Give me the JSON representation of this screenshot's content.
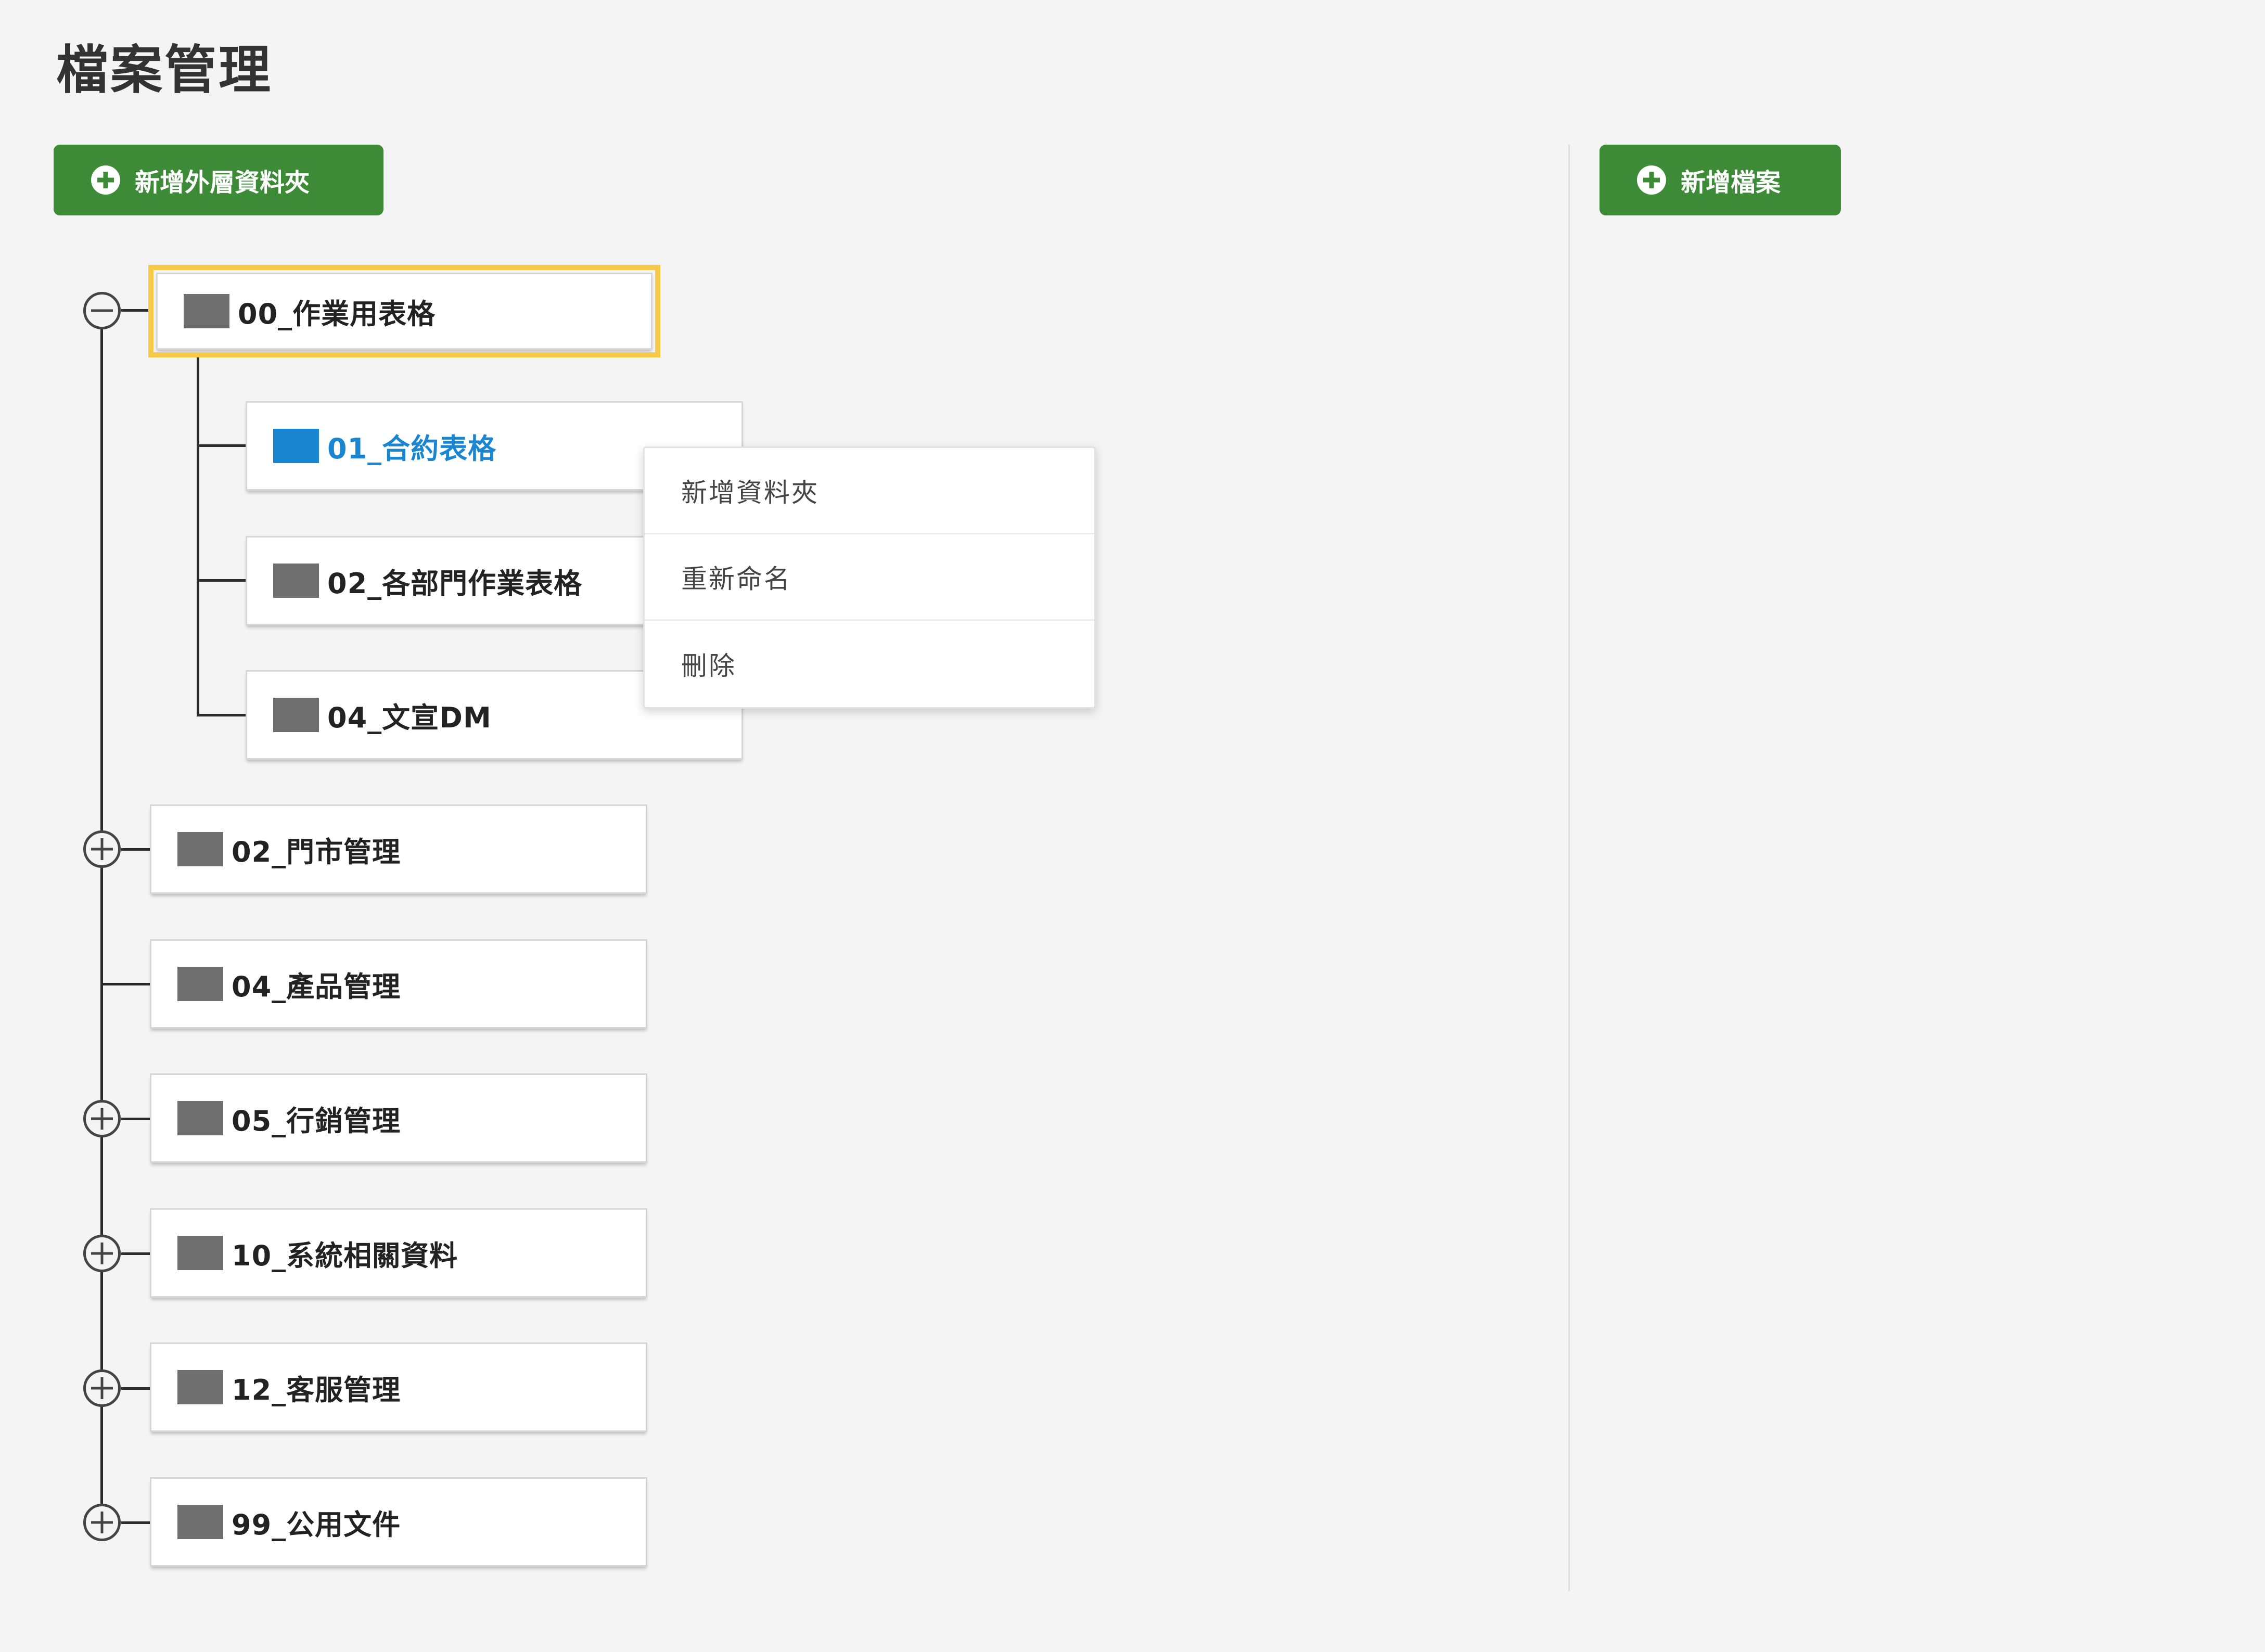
{
  "page": {
    "title": "檔案管理"
  },
  "toolbar": {
    "add_outer_folder_label": "新增外層資料夾",
    "add_file_label": "新增檔案"
  },
  "tree": {
    "root": {
      "label": "00_作業用表格",
      "expanded": true,
      "selected": true,
      "children": [
        {
          "label": "01_合約表格",
          "active": true
        },
        {
          "label": "02_各部門作業表格"
        },
        {
          "label": "04_文宣DM"
        }
      ]
    },
    "top_level": [
      {
        "label": "02_門市管理",
        "expandable": true
      },
      {
        "label": "04_產品管理",
        "expandable": false
      },
      {
        "label": "05_行銷管理",
        "expandable": true
      },
      {
        "label": "10_系統相關資料",
        "expandable": true
      },
      {
        "label": "12_客服管理",
        "expandable": true
      },
      {
        "label": "99_公用文件",
        "expandable": true
      }
    ]
  },
  "context_menu": {
    "items": [
      {
        "label": "新增資料夾"
      },
      {
        "label": "重新命名"
      },
      {
        "label": "刪除"
      }
    ]
  },
  "colors": {
    "background": "#f4f4f4",
    "button_green": "#3d8b37",
    "active_blue": "#1a86d2",
    "selected_outline": "#f7c948",
    "folder_gray": "#6f6f6f"
  }
}
